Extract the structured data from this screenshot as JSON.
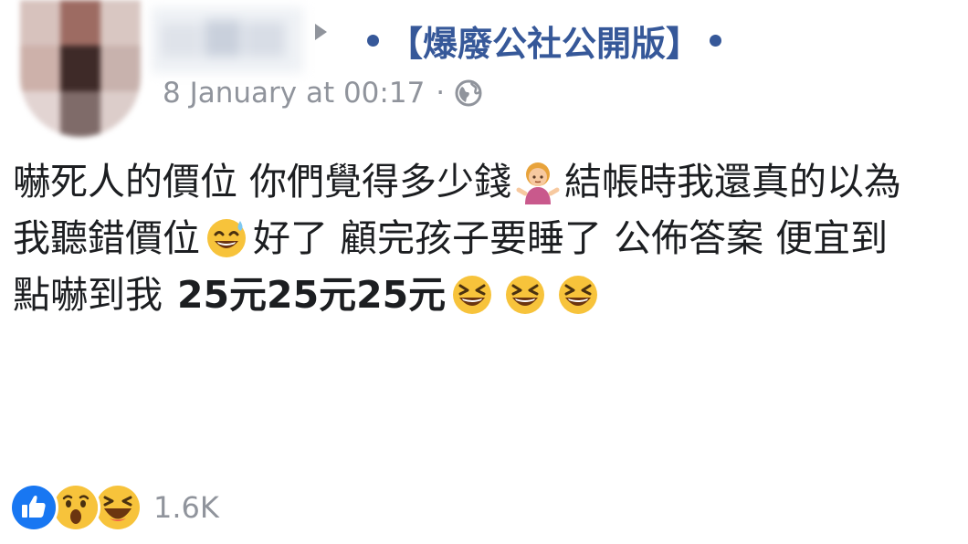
{
  "post": {
    "group_name": "【爆廢公社公開版】",
    "timestamp": "8 January at 00:17",
    "separator": "·",
    "privacy_icon": "globe-icon",
    "text": {
      "line1": "嚇死人的價位 你們覺得多少錢",
      "line1_tail": " 結帳時我還真的以為",
      "line2": "我聽錯價位",
      "line2_tail": " 好了 顧完孩子要睡了 公佈答案 便宜到",
      "line3": "點嚇到我",
      "line3_bold": "25元25元25元"
    },
    "emojis": [
      "woman-shrugging-emoji",
      "sweat-smile-emoji",
      "laughing-emoji",
      "laughing-emoji",
      "laughing-emoji"
    ]
  },
  "reactions": {
    "icons": [
      "like-icon",
      "wow-icon",
      "haha-icon"
    ],
    "count": "1.6K",
    "colors": {
      "like": "#1877f2",
      "emoji_yellow": "#f7c33b"
    }
  },
  "colors": {
    "link": "#365899",
    "meta": "#90949c",
    "text": "#1c1e21"
  }
}
